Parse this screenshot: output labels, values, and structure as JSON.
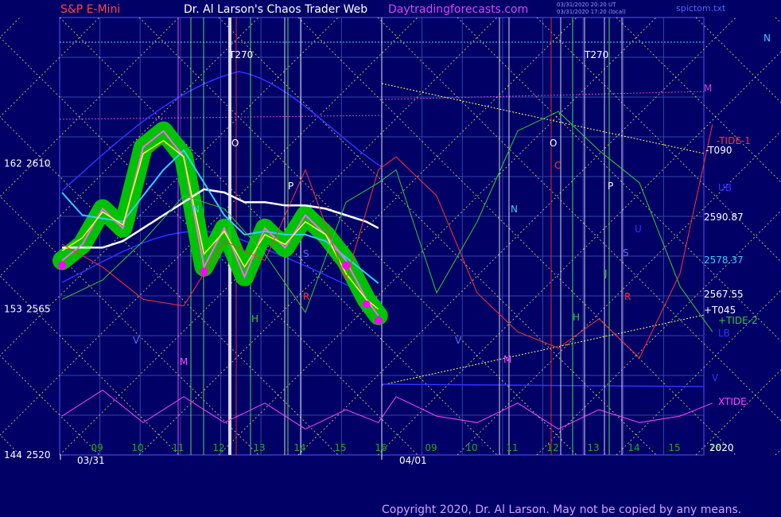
{
  "header": {
    "symbol": "S&P E-Mini",
    "title": "Dr. Al Larson's Chaos Trader Web",
    "site": "Daytradingforecasts.com",
    "stamp1": "03/31/2020 20:20 UT",
    "stamp2": "03/31/2020 17:20 (local)",
    "file": "spictom.txt"
  },
  "footer": {
    "copyright": "Copyright 2020, Dr. Al Larson. May not be copied by any means."
  },
  "colors": {
    "background": "#000066",
    "price_bars": "#ff66ff",
    "tunnel": "#00cc00",
    "fast_avg": "#ffff33",
    "mid_avg": "#33ccff",
    "slow_avg": "#ffffff",
    "tide1": "#ff3333",
    "tide2": "#33cc33",
    "xtide": "#ff44ff",
    "band": "#3333ff",
    "grid": "#ffff66",
    "magenta_line": "#cc44cc"
  },
  "chart_data": {
    "type": "line",
    "title": "S&P E-Mini",
    "ylim": [
      2520,
      2655
    ],
    "y_ticks": [
      {
        "left": "162",
        "price": "2610",
        "value": 2610
      },
      {
        "left": "153",
        "price": "2565",
        "value": 2565
      },
      {
        "left": "144",
        "price": "2520",
        "value": 2520
      }
    ],
    "x_hours": [
      "09",
      "10",
      "11",
      "12",
      "13",
      "14",
      "15",
      "16",
      "09",
      "10",
      "11",
      "12",
      "13",
      "14",
      "15",
      "16"
    ],
    "dates": [
      "03/31",
      "04/01"
    ],
    "price_levels": [
      {
        "label": "2590.87",
        "value": 2590.87,
        "color": "#ffffff"
      },
      {
        "label": "2578.37",
        "value": 2578.37,
        "color": "#33ccff"
      },
      {
        "label": "2567.55",
        "value": 2567.55,
        "color": "#ffffff"
      }
    ],
    "right_labels": [
      {
        "label": "N",
        "color": "#33ccff"
      },
      {
        "label": "M",
        "color": "#cc44cc"
      },
      {
        "label": "-TIDE-1",
        "color": "#ff3333"
      },
      {
        "label": "-T090",
        "color": "#ffffff"
      },
      {
        "label": "UB",
        "color": "#3333ff"
      },
      {
        "label": "+T045",
        "color": "#ffffff"
      },
      {
        "label": "+TIDE-2",
        "color": "#33cc33"
      },
      {
        "label": "LB",
        "color": "#3333ff"
      },
      {
        "label": "V",
        "color": "#3333ff"
      },
      {
        "label": "XTIDE",
        "color": "#ff44ff"
      },
      {
        "label": "2020",
        "color": "#ffffff"
      }
    ],
    "markers": [
      "T270",
      "O",
      "P",
      "N",
      "S",
      "R",
      "H",
      "V",
      "M",
      "C",
      "J",
      "U"
    ],
    "series": [
      {
        "name": "Price",
        "x": [
          0,
          0.5,
          1,
          1.5,
          2,
          2.5,
          3,
          3.5,
          4,
          4.5,
          5,
          5.5,
          6,
          6.5,
          7,
          7.5,
          7.8
        ],
        "values": [
          2580,
          2585,
          2596,
          2590,
          2615,
          2620,
          2612,
          2578,
          2590,
          2575,
          2590,
          2584,
          2594,
          2588,
          2580,
          2568,
          2563
        ]
      },
      {
        "name": "Fast average",
        "x": [
          0,
          0.5,
          1,
          1.5,
          2,
          2.5,
          3,
          3.5,
          4,
          4.5,
          5,
          5.5,
          6,
          6.5,
          7,
          7.5,
          7.8
        ],
        "values": [
          2583,
          2587,
          2595,
          2591,
          2613,
          2617,
          2612,
          2582,
          2589,
          2578,
          2588,
          2585,
          2592,
          2588,
          2576,
          2568,
          2565
        ]
      },
      {
        "name": "Mid average",
        "x": [
          0,
          0.5,
          1,
          1.5,
          2,
          2.5,
          3,
          3.5,
          4,
          4.5,
          5,
          5.5,
          6,
          6.5,
          7,
          7.5,
          7.8
        ],
        "values": [
          2601,
          2594,
          2593,
          2592,
          2600,
          2608,
          2614,
          2604,
          2594,
          2588,
          2589,
          2588,
          2588,
          2586,
          2581,
          2576,
          2573
        ]
      },
      {
        "name": "Slow average",
        "x": [
          0,
          0.5,
          1,
          1.5,
          2,
          2.5,
          3,
          3.5,
          4,
          4.5,
          5,
          5.5,
          6,
          6.5,
          7,
          7.5,
          7.8
        ],
        "values": [
          2584,
          2584,
          2584,
          2586,
          2590,
          2594,
          2598,
          2602,
          2601,
          2598,
          2598,
          2597,
          2597,
          2596,
          2594,
          2592,
          2590
        ]
      },
      {
        "name": "TIDE-1",
        "x": [
          0,
          1,
          2,
          3,
          4,
          5,
          6,
          7,
          7.8,
          8,
          9,
          10,
          11,
          12,
          13,
          14,
          15,
          15.8
        ],
        "values": [
          2585,
          2578,
          2568,
          2566,
          2586,
          2580,
          2608,
          2574,
          2608,
          2612,
          2600,
          2570,
          2558,
          2553,
          2562,
          2550,
          2576,
          2622
        ]
      },
      {
        "name": "TIDE-2",
        "x": [
          0,
          1,
          2,
          3,
          4,
          5,
          6,
          7,
          7.8,
          8,
          9,
          10,
          11,
          12,
          13,
          14,
          15,
          15.8
        ],
        "values": [
          2568,
          2574,
          2586,
          2600,
          2596,
          2582,
          2564,
          2598,
          2604,
          2608,
          2570,
          2592,
          2620,
          2626,
          2614,
          2604,
          2572,
          2558
        ]
      },
      {
        "name": "XTIDE",
        "x": [
          0,
          1,
          2,
          3,
          4,
          5,
          6,
          7,
          7.8,
          8,
          9,
          10,
          11,
          12,
          13,
          14,
          15,
          15.8
        ],
        "values": [
          2532,
          2540,
          2530,
          2538,
          2530,
          2536,
          2528,
          2534,
          2530,
          2538,
          2532,
          2530,
          2536,
          2528,
          2534,
          2530,
          2532,
          2536
        ]
      }
    ]
  }
}
